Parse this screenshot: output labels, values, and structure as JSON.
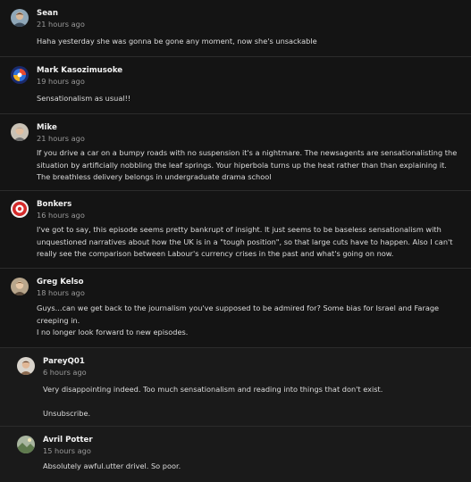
{
  "comments": [
    {
      "author": "Sean",
      "time": "21 hours ago",
      "lines": [
        "Haha yesterday she was gonna be gone any moment, now she's unsackable"
      ],
      "avatar": "person-photo-avatar"
    },
    {
      "author": "Mark Kasozimusoke",
      "time": "19 hours ago",
      "lines": [
        "Sensationalism as usual!!"
      ],
      "avatar": "colorful-logo-avatar"
    },
    {
      "author": "Mike",
      "time": "21 hours ago",
      "lines": [
        "If you drive a car on a bumpy roads with no suspension it's a nightmare. The newsagents are sensationalisting the situation by artificially nobbling the leaf springs. Your hiperbola turns up the heat rather than than explaining it. The breathless delivery belongs in undergraduate drama school"
      ],
      "avatar": "person-photo-avatar"
    },
    {
      "author": "Bonkers",
      "time": "16 hours ago",
      "lines": [
        "I've got to say, this episode seems pretty bankrupt of insight. It just seems to be baseless sensationalism with unquestioned narratives about how the UK is in a \"tough position\", so that large cuts have to happen. Also I can't really see the comparison between Labour's currency crises in the past and what's going on now."
      ],
      "avatar": "red-emblem-avatar"
    },
    {
      "author": "Greg Kelso",
      "time": "18 hours ago",
      "lines": [
        "Guys...can we get back to the journalism you've supposed to be admired for? Some bias for Israel and Farage creeping in.",
        "I no longer look forward to new episodes."
      ],
      "avatar": "person-photo-avatar"
    },
    {
      "author": "PareyQ01",
      "time": "6 hours ago",
      "lines": [
        "Very disappointing indeed. Too much sensationalism and reading into things that don't exist.",
        "Unsubscribe."
      ],
      "avatar": "person-photo-avatar"
    },
    {
      "author": "Avril Potter",
      "time": "15 hours ago",
      "lines": [
        "Absolutely awful.utter drivel. So poor."
      ],
      "avatar": "landscape-photo-avatar"
    }
  ],
  "colors": {
    "background": "#141414",
    "reply_background": "#1a1a1a",
    "divider": "#2c2c2c",
    "author_text": "#f2f2f2",
    "time_text": "#9a9a9a",
    "body_text": "#dcdcdc"
  }
}
